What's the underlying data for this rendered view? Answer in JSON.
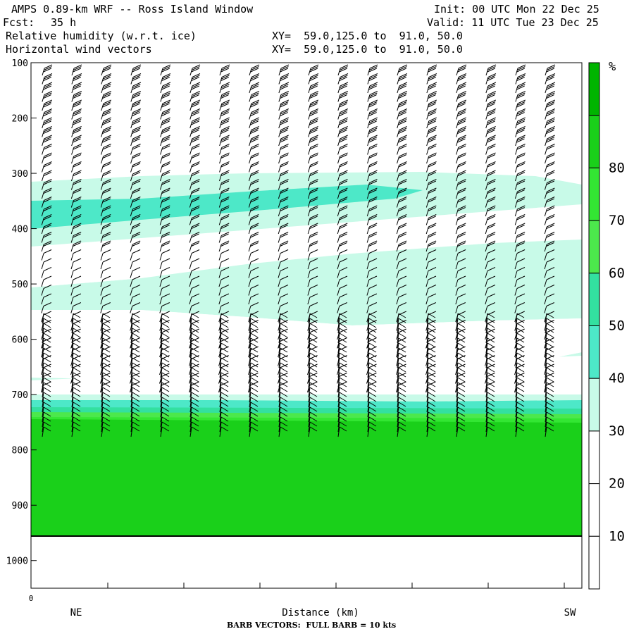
{
  "header": {
    "title": "AMPS 0.89-km WRF -- Ross Island Window",
    "init": "Init: 00 UTC Mon 22 Dec 25",
    "fcst_label": "Fcst:",
    "fcst_value": "35 h",
    "valid": "Valid: 11 UTC Tue 23 Dec 25",
    "field1": "Relative humidity (w.r.t. ice)",
    "field2": "Horizontal wind vectors",
    "xy1": "XY=  59.0,125.0 to  91.0, 50.0",
    "xy2": "XY=  59.0,125.0 to  91.0, 50.0"
  },
  "footer": {
    "barb_note": "BARB VECTORS:  FULL BARB = 10 kts"
  },
  "chart_data": {
    "type": "heatmap",
    "title": "Relative humidity (w.r.t. ice)",
    "xlabel": "Distance (km)",
    "ylabel": "",
    "x_origin_label": "0",
    "x_left_label": "NE",
    "x_right_label": "SW",
    "y_axis": {
      "range": [
        100,
        1050
      ],
      "inverted": true,
      "ticks": [
        "100",
        "200",
        "300",
        "400",
        "500",
        "600",
        "700",
        "800",
        "900",
        "1000"
      ]
    },
    "colorbar": {
      "unit": "%",
      "tick_labels": [
        "10",
        "20",
        "30",
        "40",
        "50",
        "60",
        "70",
        "80"
      ],
      "colors": [
        "#ffffff",
        "#ffffff",
        "#ffffff",
        "#c8fae8",
        "#4de8c8",
        "#33e0a0",
        "#4ce84c",
        "#33e633",
        "#1ad01a",
        "#00b400"
      ]
    },
    "rh_layers": [
      {
        "name": "moist layer 300-400 hPa",
        "rh_range": [
          30,
          40
        ]
      },
      {
        "name": "moist core ~330-380 hPa",
        "rh_range": [
          40,
          50
        ]
      },
      {
        "name": "mid layer 450-560 hPa",
        "rh_range": [
          30,
          40
        ]
      },
      {
        "name": "boundary layer 700-760 hPa",
        "rh_range": [
          30,
          90
        ]
      }
    ],
    "wind_barb_columns": 18,
    "surface_pressure_hpa": 760
  }
}
